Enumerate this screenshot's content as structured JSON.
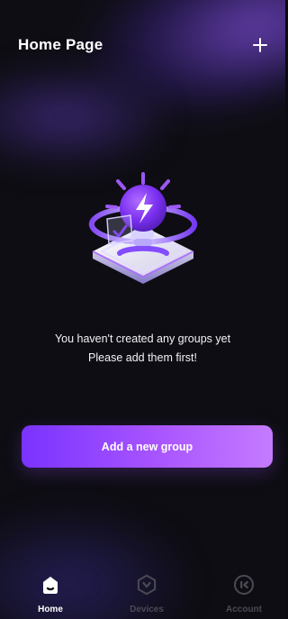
{
  "header": {
    "title": "Home Page",
    "add_icon": "plus-icon"
  },
  "empty_state": {
    "illustration": "lightbulb-illustration",
    "line1": "You haven't created any groups yet",
    "line2": "Please add them first!"
  },
  "primary_button": {
    "label": "Add a new group"
  },
  "tabbar": {
    "tabs": [
      {
        "label": "Home",
        "icon": "home-icon",
        "active": true
      },
      {
        "label": "Devices",
        "icon": "devices-icon",
        "active": false
      },
      {
        "label": "Account",
        "icon": "account-icon",
        "active": false
      }
    ]
  },
  "colors": {
    "background": "#0e0d13",
    "accent": "#9b4dff",
    "accent_gradient_start": "#7a33ff",
    "accent_gradient_end": "#c57bff",
    "inactive_tab": "#4a4a55"
  }
}
